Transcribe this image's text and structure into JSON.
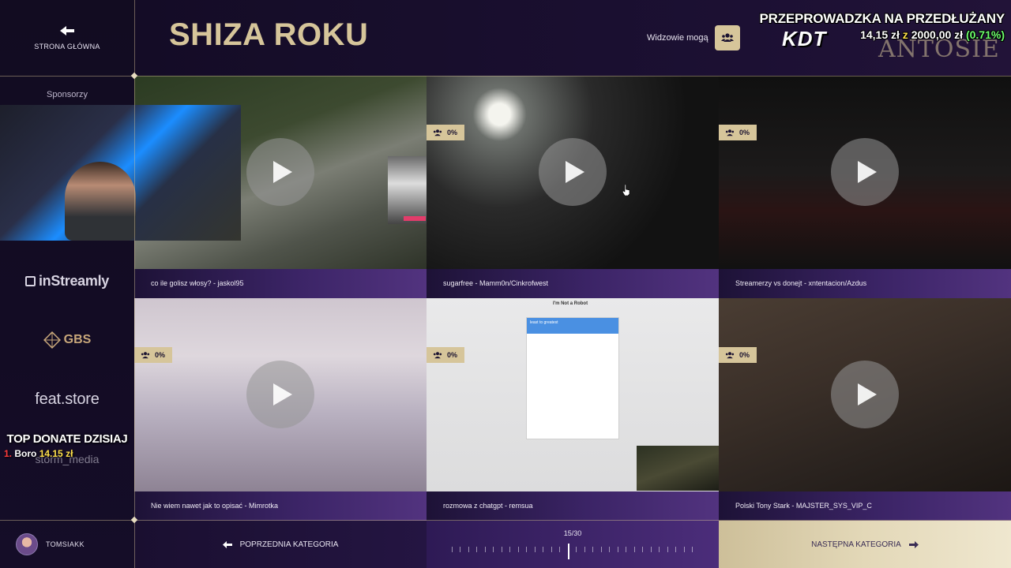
{
  "sidebar": {
    "home_label": "STRONA GŁÓWNA",
    "sponsors_label": "Sponsorzy",
    "sponsors": [
      "inStreamly",
      "GBS",
      "feat.store",
      "storm_media"
    ],
    "user_name": "TOMSIAKK"
  },
  "header": {
    "title": "SHIZA ROKU",
    "viewers_label": "Widzowie mogą"
  },
  "stream_overlay": {
    "goal_title": "PRZEPROWADZKA NA PRZEDŁUŻANY",
    "goal_current": "14,15 zł",
    "goal_sep": "z",
    "goal_target": "2000,00 zł",
    "goal_percent": "(0.71%)",
    "brand_left": "KDT",
    "brand_right": "ANTOSIE",
    "top_donate_title": "TOP DONATE DZISIAJ",
    "top_donate_rank": "1.",
    "top_donate_name": "Boro",
    "top_donate_amount": "14.15 zł"
  },
  "tiles": [
    {
      "caption": "co ile golisz włosy? - jaskol95",
      "percent": null
    },
    {
      "caption": "sugarfree - Mamm0n/Cinkrofwest",
      "percent": "0%"
    },
    {
      "caption": "Streamerzy vs donejt - xntentacion/Azdus",
      "percent": "0%"
    },
    {
      "caption": "Nie wiem nawet jak to opisać - Mimrotka",
      "percent": "0%"
    },
    {
      "caption": "rozmowa z chatgpt - remsua",
      "percent": "0%"
    },
    {
      "caption": "Polski Tony Stark - MAJSTER_SYS_VIP_C",
      "percent": "0%"
    }
  ],
  "captcha": {
    "title": "I'm Not a Robot",
    "prompt": "least to greatest"
  },
  "footer": {
    "prev_label": "POPRZEDNIA KATEGORIA",
    "next_label": "NASTĘPNA KATEGORIA",
    "page_counter": "15/30",
    "page_current": 15,
    "page_total": 30
  },
  "colors": {
    "accent": "#d6c59a",
    "background": "#120c21",
    "caption_purple": "#3b2466"
  }
}
